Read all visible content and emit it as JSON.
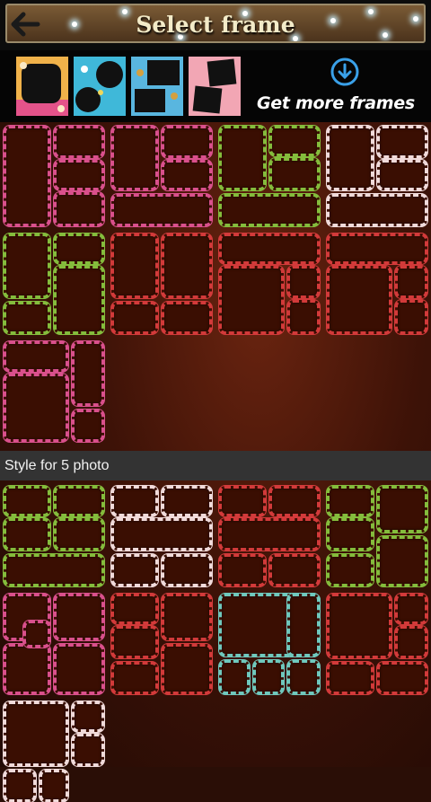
{
  "header": {
    "title": "Select frame",
    "back_icon": "back-arrow-icon"
  },
  "frame_strip": {
    "thumbnails": [
      {
        "name": "frame-thumb-orange-cake",
        "icon": "photo-frame-icon"
      },
      {
        "name": "frame-thumb-blue-circles",
        "icon": "photo-frame-icon"
      },
      {
        "name": "frame-thumb-blue-stars",
        "icon": "photo-frame-icon"
      },
      {
        "name": "frame-thumb-pink-tilted",
        "icon": "photo-frame-icon"
      }
    ],
    "get_more_label": "Get more frames",
    "get_more_icon": "download-circle-icon"
  },
  "section_5": {
    "label": "Style for 5 photo"
  },
  "colors": {
    "pink": "#d9508c",
    "green": "#84bc3c",
    "white": "#f0dada",
    "red": "#d23a3a",
    "cyan": "#6fc8bd",
    "cell_fill": "#3a0e02"
  }
}
